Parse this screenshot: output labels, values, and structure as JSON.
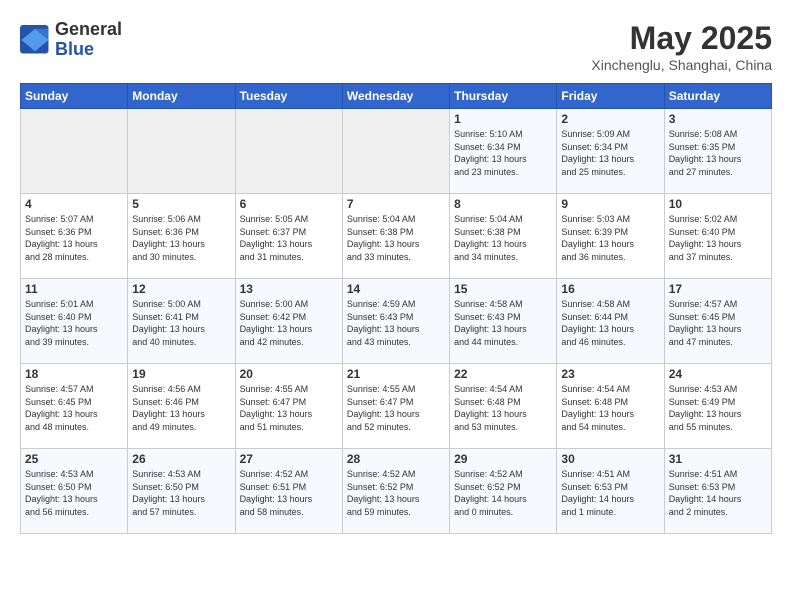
{
  "header": {
    "logo_general": "General",
    "logo_blue": "Blue",
    "month_year": "May 2025",
    "location": "Xinchenglu, Shanghai, China"
  },
  "days_of_week": [
    "Sunday",
    "Monday",
    "Tuesday",
    "Wednesday",
    "Thursday",
    "Friday",
    "Saturday"
  ],
  "weeks": [
    [
      {
        "day": "",
        "info": ""
      },
      {
        "day": "",
        "info": ""
      },
      {
        "day": "",
        "info": ""
      },
      {
        "day": "",
        "info": ""
      },
      {
        "day": "1",
        "info": "Sunrise: 5:10 AM\nSunset: 6:34 PM\nDaylight: 13 hours\nand 23 minutes."
      },
      {
        "day": "2",
        "info": "Sunrise: 5:09 AM\nSunset: 6:34 PM\nDaylight: 13 hours\nand 25 minutes."
      },
      {
        "day": "3",
        "info": "Sunrise: 5:08 AM\nSunset: 6:35 PM\nDaylight: 13 hours\nand 27 minutes."
      }
    ],
    [
      {
        "day": "4",
        "info": "Sunrise: 5:07 AM\nSunset: 6:36 PM\nDaylight: 13 hours\nand 28 minutes."
      },
      {
        "day": "5",
        "info": "Sunrise: 5:06 AM\nSunset: 6:36 PM\nDaylight: 13 hours\nand 30 minutes."
      },
      {
        "day": "6",
        "info": "Sunrise: 5:05 AM\nSunset: 6:37 PM\nDaylight: 13 hours\nand 31 minutes."
      },
      {
        "day": "7",
        "info": "Sunrise: 5:04 AM\nSunset: 6:38 PM\nDaylight: 13 hours\nand 33 minutes."
      },
      {
        "day": "8",
        "info": "Sunrise: 5:04 AM\nSunset: 6:38 PM\nDaylight: 13 hours\nand 34 minutes."
      },
      {
        "day": "9",
        "info": "Sunrise: 5:03 AM\nSunset: 6:39 PM\nDaylight: 13 hours\nand 36 minutes."
      },
      {
        "day": "10",
        "info": "Sunrise: 5:02 AM\nSunset: 6:40 PM\nDaylight: 13 hours\nand 37 minutes."
      }
    ],
    [
      {
        "day": "11",
        "info": "Sunrise: 5:01 AM\nSunset: 6:40 PM\nDaylight: 13 hours\nand 39 minutes."
      },
      {
        "day": "12",
        "info": "Sunrise: 5:00 AM\nSunset: 6:41 PM\nDaylight: 13 hours\nand 40 minutes."
      },
      {
        "day": "13",
        "info": "Sunrise: 5:00 AM\nSunset: 6:42 PM\nDaylight: 13 hours\nand 42 minutes."
      },
      {
        "day": "14",
        "info": "Sunrise: 4:59 AM\nSunset: 6:43 PM\nDaylight: 13 hours\nand 43 minutes."
      },
      {
        "day": "15",
        "info": "Sunrise: 4:58 AM\nSunset: 6:43 PM\nDaylight: 13 hours\nand 44 minutes."
      },
      {
        "day": "16",
        "info": "Sunrise: 4:58 AM\nSunset: 6:44 PM\nDaylight: 13 hours\nand 46 minutes."
      },
      {
        "day": "17",
        "info": "Sunrise: 4:57 AM\nSunset: 6:45 PM\nDaylight: 13 hours\nand 47 minutes."
      }
    ],
    [
      {
        "day": "18",
        "info": "Sunrise: 4:57 AM\nSunset: 6:45 PM\nDaylight: 13 hours\nand 48 minutes."
      },
      {
        "day": "19",
        "info": "Sunrise: 4:56 AM\nSunset: 6:46 PM\nDaylight: 13 hours\nand 49 minutes."
      },
      {
        "day": "20",
        "info": "Sunrise: 4:55 AM\nSunset: 6:47 PM\nDaylight: 13 hours\nand 51 minutes."
      },
      {
        "day": "21",
        "info": "Sunrise: 4:55 AM\nSunset: 6:47 PM\nDaylight: 13 hours\nand 52 minutes."
      },
      {
        "day": "22",
        "info": "Sunrise: 4:54 AM\nSunset: 6:48 PM\nDaylight: 13 hours\nand 53 minutes."
      },
      {
        "day": "23",
        "info": "Sunrise: 4:54 AM\nSunset: 6:48 PM\nDaylight: 13 hours\nand 54 minutes."
      },
      {
        "day": "24",
        "info": "Sunrise: 4:53 AM\nSunset: 6:49 PM\nDaylight: 13 hours\nand 55 minutes."
      }
    ],
    [
      {
        "day": "25",
        "info": "Sunrise: 4:53 AM\nSunset: 6:50 PM\nDaylight: 13 hours\nand 56 minutes."
      },
      {
        "day": "26",
        "info": "Sunrise: 4:53 AM\nSunset: 6:50 PM\nDaylight: 13 hours\nand 57 minutes."
      },
      {
        "day": "27",
        "info": "Sunrise: 4:52 AM\nSunset: 6:51 PM\nDaylight: 13 hours\nand 58 minutes."
      },
      {
        "day": "28",
        "info": "Sunrise: 4:52 AM\nSunset: 6:52 PM\nDaylight: 13 hours\nand 59 minutes."
      },
      {
        "day": "29",
        "info": "Sunrise: 4:52 AM\nSunset: 6:52 PM\nDaylight: 14 hours\nand 0 minutes."
      },
      {
        "day": "30",
        "info": "Sunrise: 4:51 AM\nSunset: 6:53 PM\nDaylight: 14 hours\nand 1 minute."
      },
      {
        "day": "31",
        "info": "Sunrise: 4:51 AM\nSunset: 6:53 PM\nDaylight: 14 hours\nand 2 minutes."
      }
    ]
  ]
}
